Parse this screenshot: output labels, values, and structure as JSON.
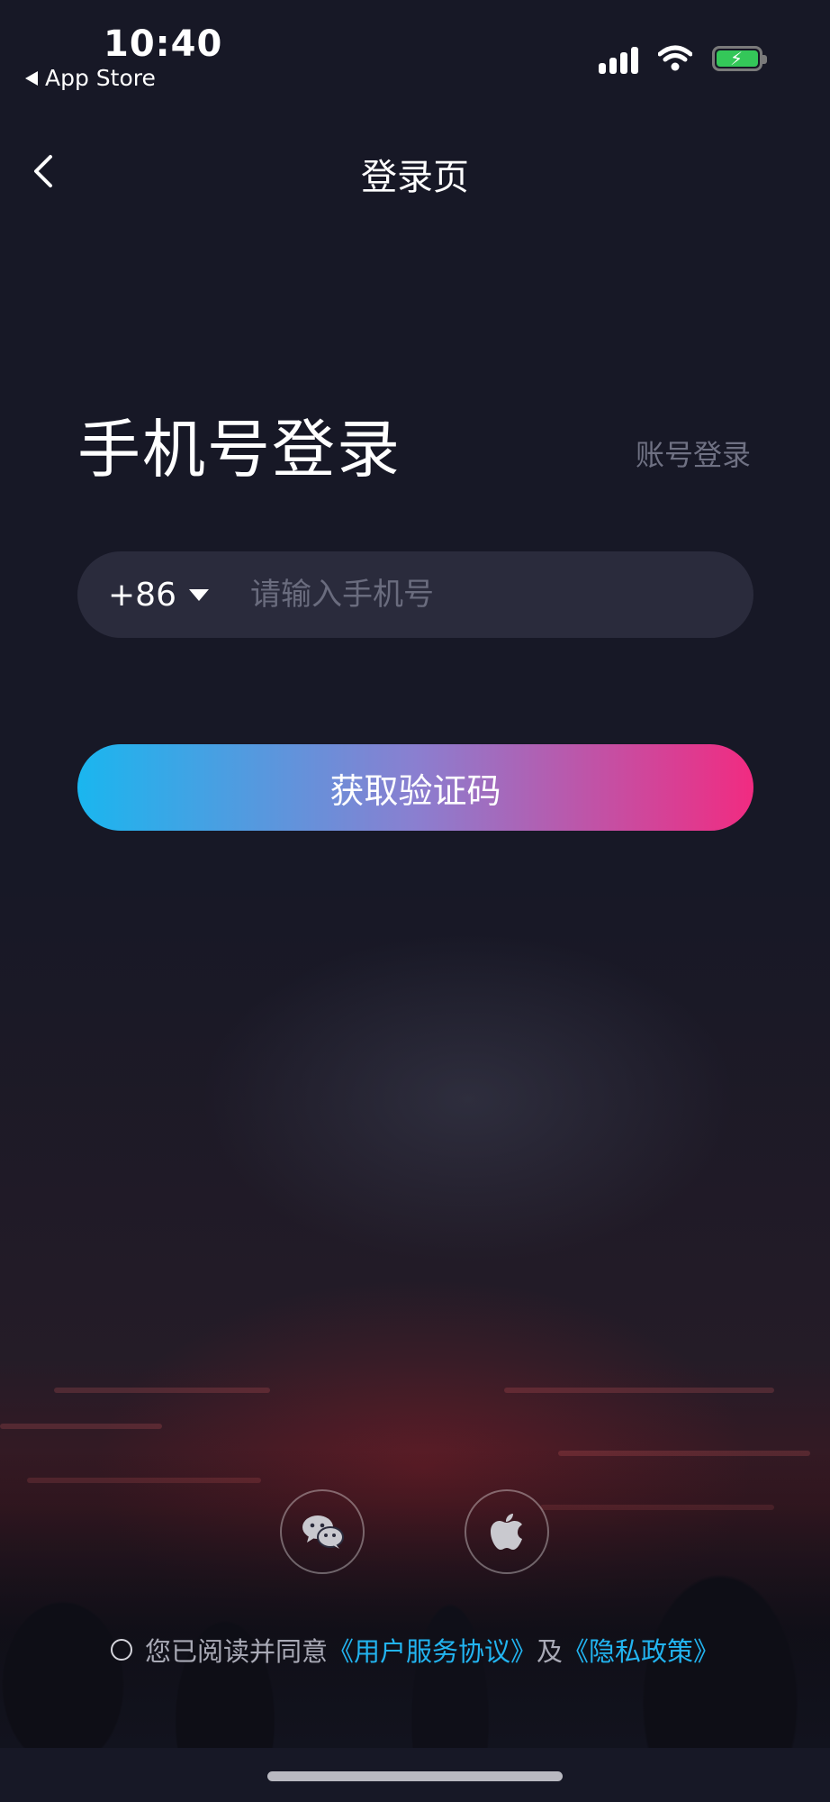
{
  "status_bar": {
    "time": "10:40",
    "back_app": "App Store"
  },
  "nav": {
    "title": "登录页"
  },
  "login": {
    "heading": "手机号登录",
    "switch_label": "账号登录",
    "country_code": "+86",
    "phone_placeholder": "请输入手机号",
    "phone_value": "",
    "submit_label": "获取验证码"
  },
  "social": {
    "wechat_icon": "wechat-icon",
    "apple_icon": "apple-icon"
  },
  "agreement": {
    "prefix": "您已阅读并同意",
    "user_agreement": "《用户服务协议》",
    "and": "及",
    "privacy_policy": "《隐私政策》"
  },
  "colors": {
    "background": "#171826",
    "accent_blue": "#1ab6ef",
    "accent_pink": "#f12b81",
    "link": "#22b4f0"
  }
}
